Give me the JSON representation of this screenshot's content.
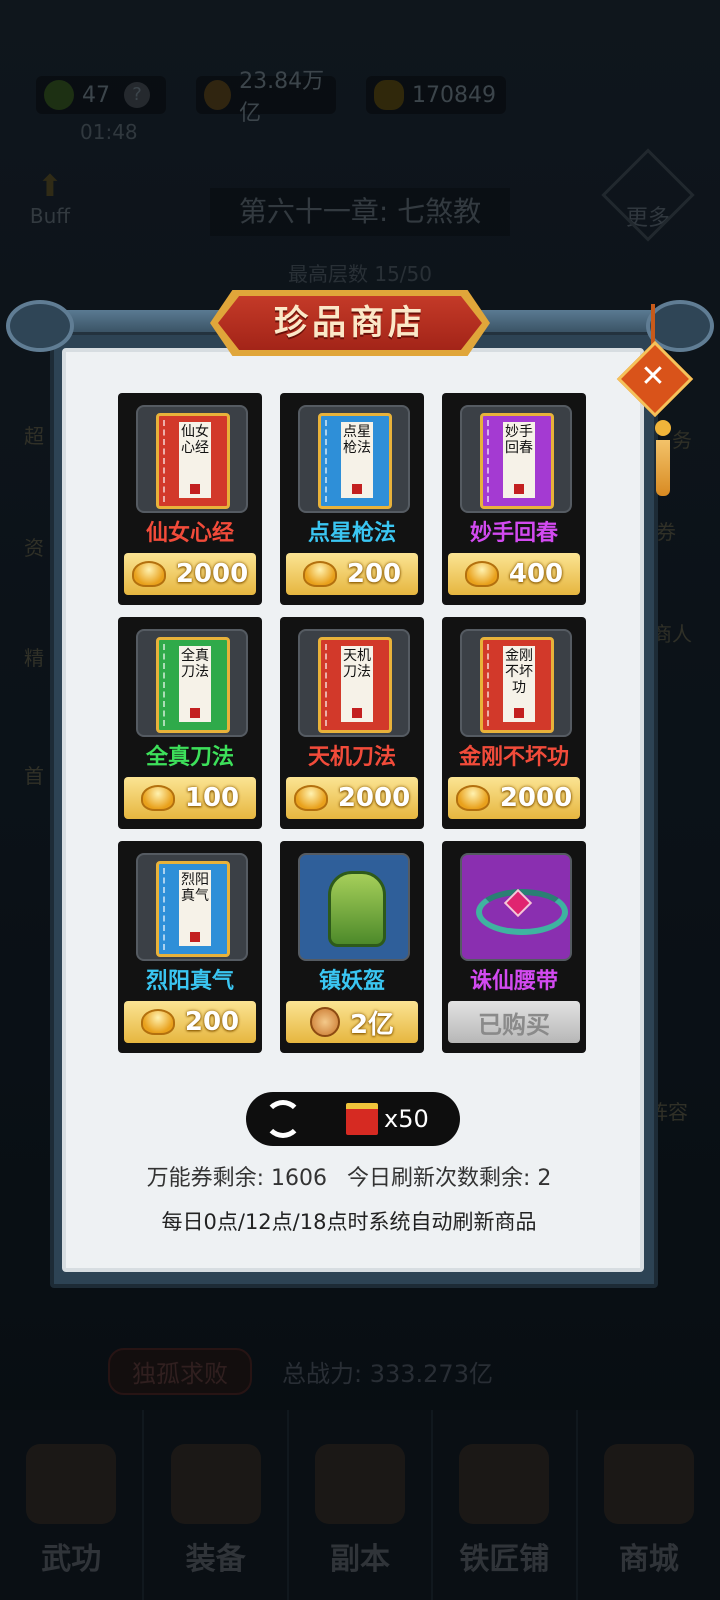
{
  "background": {
    "resources": [
      {
        "icon": "jade-icon",
        "value": "47",
        "extra": "?"
      },
      {
        "icon": "copper-coin-icon",
        "value": "23.84万亿"
      },
      {
        "icon": "gold-ingot-icon",
        "value": "170849"
      }
    ],
    "timer": "01:48",
    "buff_label": "Buff",
    "chapter_title": "第六十一章: 七煞教",
    "floors": "最高层数 15/50",
    "more_label": "更多",
    "left_side": [
      "超",
      "资",
      "精",
      "首"
    ],
    "right_side": [
      "务",
      "券",
      "商人",
      "阵容"
    ],
    "power_tag": "独孤求败",
    "power_text": "总战力: 333.273亿",
    "nav": [
      "武功",
      "装备",
      "副本",
      "铁匠铺",
      "商城"
    ]
  },
  "shop": {
    "title": "珍品商店",
    "close_icon": "close-icon",
    "items": [
      {
        "name": "仙女心经",
        "book_text": "仙女心经",
        "book_color": "#d2392a",
        "name_color": "#f24b3a",
        "price": "2000",
        "currency": "gold",
        "type": "book"
      },
      {
        "name": "点星枪法",
        "book_text": "点星枪法",
        "book_color": "#2e8fd8",
        "name_color": "#3ac6f2",
        "price": "200",
        "currency": "gold",
        "type": "book"
      },
      {
        "name": "妙手回春",
        "book_text": "妙手回春",
        "book_color": "#a43ad2",
        "name_color": "#d24af0",
        "price": "400",
        "currency": "gold",
        "type": "book"
      },
      {
        "name": "全真刀法",
        "book_text": "全真刀法",
        "book_color": "#2faa4a",
        "name_color": "#3de05a",
        "price": "100",
        "currency": "gold",
        "type": "book"
      },
      {
        "name": "天机刀法",
        "book_text": "天机刀法",
        "book_color": "#d2392a",
        "name_color": "#f24b3a",
        "price": "2000",
        "currency": "gold",
        "type": "book"
      },
      {
        "name": "金刚不坏功",
        "book_text": "金刚不坏功",
        "book_color": "#d2392a",
        "name_color": "#f24b3a",
        "price": "2000",
        "currency": "gold",
        "type": "book"
      },
      {
        "name": "烈阳真气",
        "book_text": "烈阳真气",
        "book_color": "#2e8fd8",
        "name_color": "#3ac6f2",
        "price": "200",
        "currency": "gold",
        "type": "book"
      },
      {
        "name": "镇妖盔",
        "name_color": "#3ac6f2",
        "price": "2亿",
        "currency": "coin",
        "type": "helmet",
        "box_color": "#2f5f9a"
      },
      {
        "name": "诛仙腰带",
        "name_color": "#d24af0",
        "price": "已购买",
        "currency": "none",
        "type": "belt",
        "box_color": "#8a2fb0",
        "sold": true
      }
    ],
    "refresh_count": "x50",
    "voucher_remaining": "万能券剩余: 1606",
    "refresh_remaining": "今日刷新次数剩余: 2",
    "auto_refresh_note": "每日0点/12点/18点时系统自动刷新商品"
  }
}
